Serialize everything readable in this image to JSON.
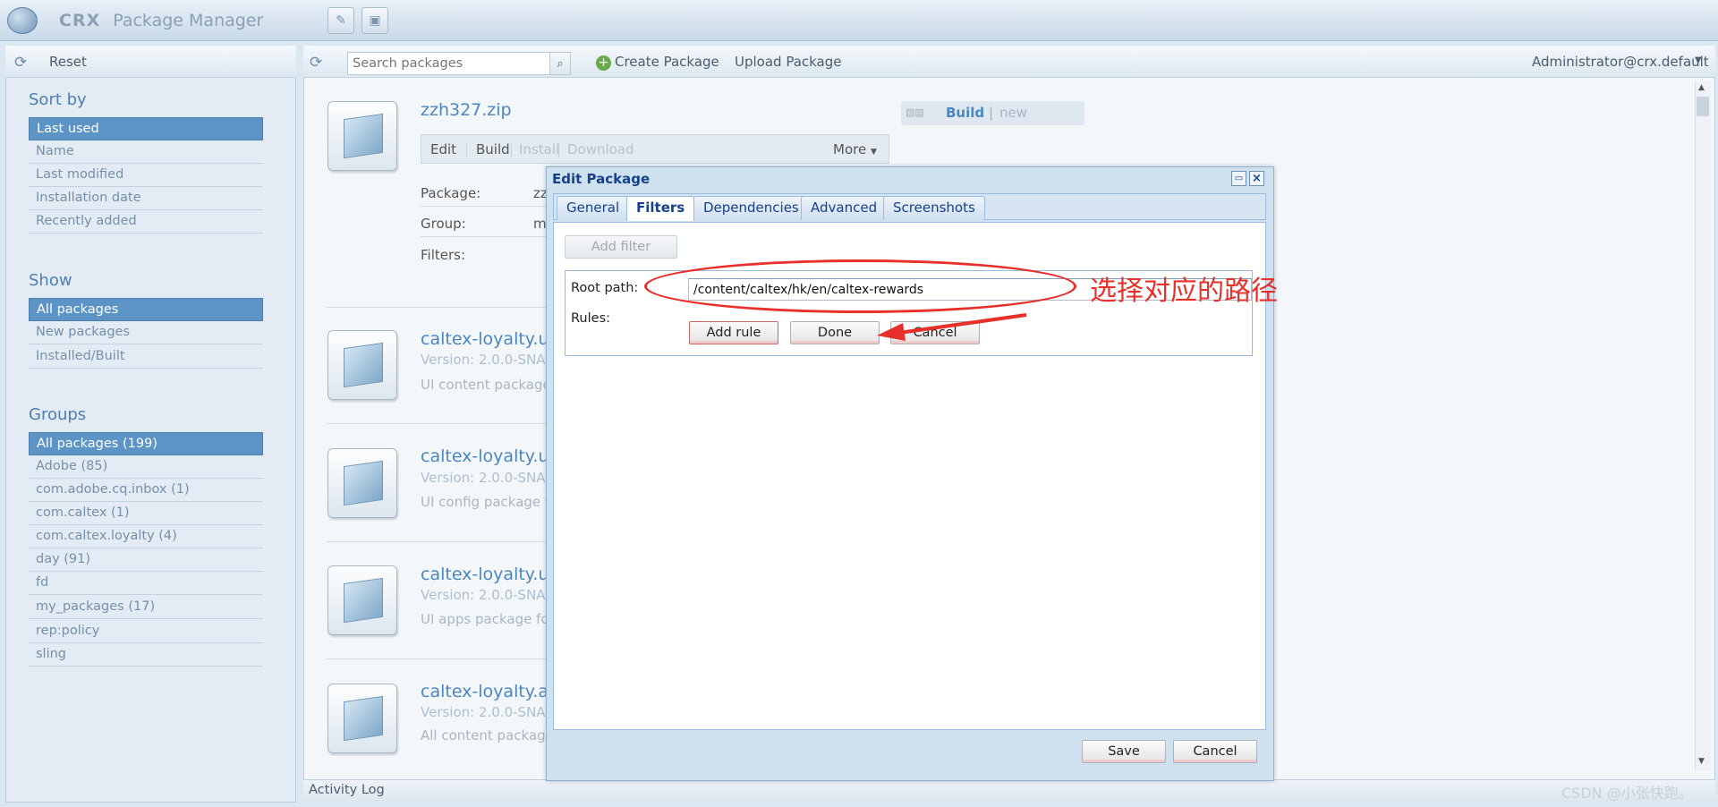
{
  "app": {
    "brand": "CRX",
    "title": "Package Manager"
  },
  "left": {
    "reset_label": "Reset",
    "sort_title": "Sort by",
    "sort_items": [
      "Last used",
      "Name",
      "Last modified",
      "Installation date",
      "Recently added"
    ],
    "show_title": "Show",
    "show_items": [
      "All packages",
      "New packages",
      "Installed/Built"
    ],
    "groups_title": "Groups",
    "group_items": [
      "All packages (199)",
      "Adobe (85)",
      "com.adobe.cq.inbox (1)",
      "com.caltex (1)",
      "com.caltex.loyalty (4)",
      "day (91)",
      "fd",
      "my_packages (17)",
      "rep:policy",
      "sling"
    ]
  },
  "toolbar": {
    "search_placeholder": "Search packages",
    "create_label": "Create Package",
    "upload_label": "Upload Package",
    "user_label": "Administrator@crx.default"
  },
  "first_pkg": {
    "title": "zzh327.zip",
    "actions": [
      "Edit",
      "Build",
      "Install",
      "Download"
    ],
    "more_label": "More",
    "build_label": "Build",
    "build_sep": "|",
    "new_label": "new",
    "fields": [
      {
        "label": "Package:",
        "value": "zz"
      },
      {
        "label": "Group:",
        "value": "m"
      },
      {
        "label": "Filters:",
        "value": ""
      }
    ]
  },
  "packages": [
    {
      "title": "caltex-loyalty.u",
      "version": "Version: 2.0.0-SNA",
      "desc": "UI content package"
    },
    {
      "title": "caltex-loyalty.u",
      "version": "Version: 2.0.0-SNA",
      "desc": "UI config package f"
    },
    {
      "title": "caltex-loyalty.u",
      "version": "Version: 2.0.0-SNA",
      "desc": "UI apps package fo"
    },
    {
      "title": "caltex-loyalty.a",
      "version": "Version: 2.0.0-SNA",
      "desc": "All content package"
    }
  ],
  "activity_label": "Activity Log",
  "dialog": {
    "title": "Edit Package",
    "tabs": [
      "General",
      "Filters",
      "Dependencies",
      "Advanced",
      "Screenshots"
    ],
    "active_tab": "Filters",
    "add_filter_label": "Add filter",
    "root_path_label": "Root path:",
    "root_path_value": "/content/caltex/hk/en/caltex-rewards",
    "rules_label": "Rules:",
    "add_rule_label": "Add rule",
    "done_label": "Done",
    "cancel_inner_label": "Cancel",
    "save_label": "Save",
    "cancel_label": "Cancel"
  },
  "annotation": {
    "text": "选择对应的路径",
    "color": "#e8302a"
  },
  "watermark": "CSDN @小张快跑。",
  "colors": {
    "selected_nav": "#5b94c5",
    "link_blue": "#4b86c0",
    "dialog_title": "#15428b"
  }
}
